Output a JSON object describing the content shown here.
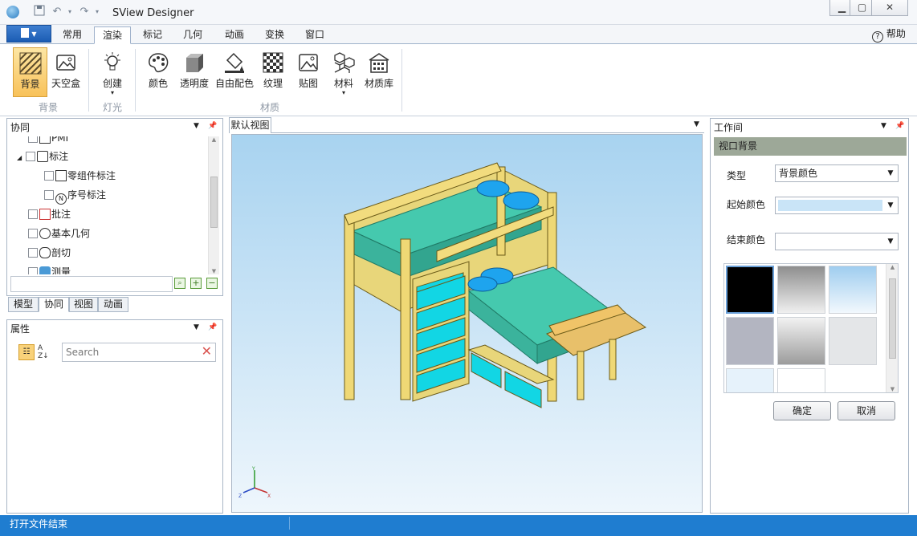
{
  "app": {
    "title": "SView Designer"
  },
  "file_menu": {
    "label": "▼"
  },
  "tabs": [
    "常用",
    "渲染",
    "标记",
    "几何",
    "动画",
    "变换",
    "窗口"
  ],
  "help": {
    "label": "帮助"
  },
  "ribbon": {
    "background_group": {
      "label": "背景",
      "buttons": [
        "背景",
        "天空盒"
      ]
    },
    "light_group": {
      "label": "灯光",
      "buttons": [
        "创建"
      ]
    },
    "material_group": {
      "label": "材质",
      "buttons": [
        "颜色",
        "透明度",
        "自由配色",
        "纹理",
        "贴图",
        "材料",
        "材质库"
      ]
    }
  },
  "collab_panel": {
    "title": "协同",
    "items": [
      {
        "label": "PMI",
        "indent": 2
      },
      {
        "label": "标注",
        "indent": 1,
        "expanded": true
      },
      {
        "label": "零组件标注",
        "indent": 2
      },
      {
        "label": "序号标注",
        "indent": 2
      },
      {
        "label": "批注",
        "indent": 1
      },
      {
        "label": "基本几何",
        "indent": 1
      },
      {
        "label": "剖切",
        "indent": 1
      },
      {
        "label": "测量",
        "indent": 1
      }
    ],
    "bottom_tabs": [
      "模型",
      "协同",
      "视图",
      "动画"
    ]
  },
  "props_panel": {
    "title": "属性",
    "search_placeholder": "Search"
  },
  "viewport": {
    "tab": "默认视图"
  },
  "workspace_panel": {
    "title": "工作间",
    "section": "视口背景",
    "type_label": "类型",
    "type_value": "背景颜色",
    "start_label": "起始颜色",
    "end_label": "结束颜色",
    "ok": "确定",
    "cancel": "取消"
  },
  "colors": {
    "accent": "#1f7dd0",
    "ribbon_selected": "#f8c25a",
    "section_header": "#9da898",
    "viewport_top": "#a8d3f0",
    "viewport_bottom": "#eef6fc",
    "start_color": "#c9e4f7"
  },
  "status": {
    "text": "打开文件结束"
  }
}
